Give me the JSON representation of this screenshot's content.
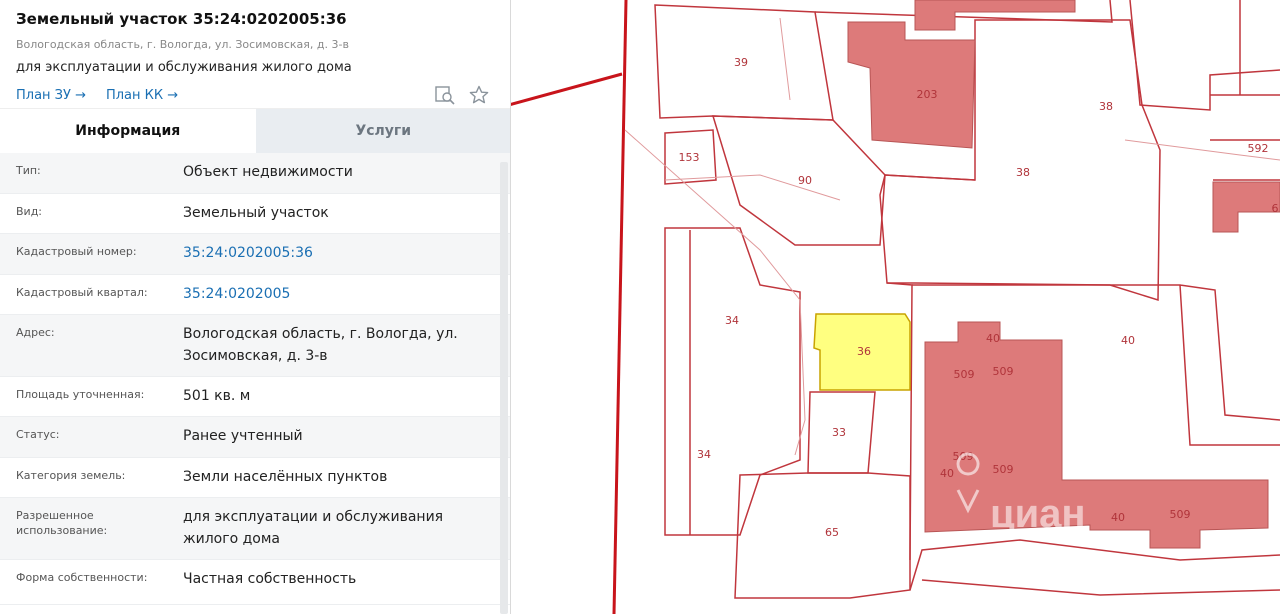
{
  "header": {
    "title": "Земельный участок 35:24:0202005:36",
    "address_small": "Вологодская область, г. Вологда, ул. Зосимовская, д. 3-в",
    "purpose": "для эксплуатации и обслуживания жилого дома",
    "plan_zu": "План ЗУ →",
    "plan_kk": "План КК →"
  },
  "tabs": {
    "info": "Информация",
    "services": "Услуги"
  },
  "rows": [
    {
      "label": "Тип:",
      "value": "Объект недвижимости"
    },
    {
      "label": "Вид:",
      "value": "Земельный участок"
    },
    {
      "label": "Кадастровый номер:",
      "value": "35:24:0202005:36"
    },
    {
      "label": "Кадастровый квартал:",
      "value": "35:24:0202005"
    },
    {
      "label": "Адрес:",
      "value": "Вологодская область, г. Вологда, ул. Зосимовская, д. 3-в"
    },
    {
      "label": "Площадь уточненная:",
      "value": "501 кв. м"
    },
    {
      "label": "Статус:",
      "value": "Ранее учтенный"
    },
    {
      "label": "Категория земель:",
      "value": "Земли населённых пунктов"
    },
    {
      "label": "Разрешенное использование:",
      "value": "для эксплуатации и обслуживания жилого дома"
    },
    {
      "label": "Форма собственности:",
      "value": "Частная собственность"
    }
  ],
  "map": {
    "labels": {
      "l39": "39",
      "l203": "203",
      "l38a": "38",
      "l38b": "38",
      "l592": "592",
      "l153": "153",
      "l90": "90",
      "l6": "6",
      "l34a": "34",
      "l34b": "34",
      "l36": "36",
      "l40a": "40",
      "l40b": "40",
      "l40c": "40",
      "l40d": "40",
      "l509a": "509",
      "l509b": "509",
      "l509c": "509",
      "l509d": "509",
      "l509e": "509",
      "l33": "33",
      "l65": "65"
    },
    "watermark": "циан",
    "colors": {
      "parcel_line": "#c0363d",
      "building": "#dd7a7a",
      "selected": "#ffff80",
      "road": "#c8141b"
    }
  }
}
